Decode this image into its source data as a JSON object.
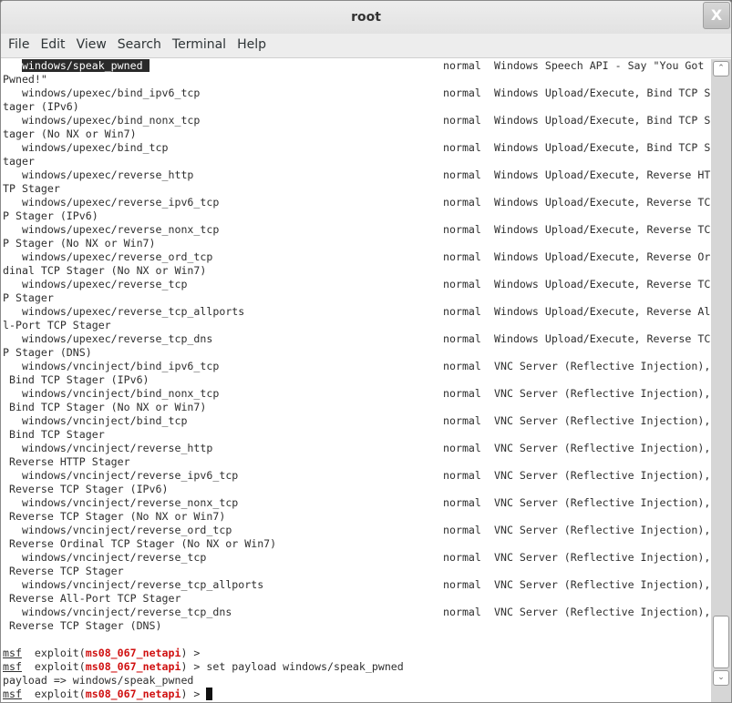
{
  "window": {
    "title": "root",
    "close_label": "X"
  },
  "menu": [
    "File",
    "Edit",
    "View",
    "Search",
    "Terminal",
    "Help"
  ],
  "entries": [
    {
      "name": "windows/speak_pwned",
      "rank": "normal",
      "desc": "Windows Speech API - Say \"You Got",
      "cont": "Pwned!\"",
      "selected": true
    },
    {
      "name": "windows/upexec/bind_ipv6_tcp",
      "rank": "normal",
      "desc": "Windows Upload/Execute, Bind TCP S",
      "cont": "tager (IPv6)"
    },
    {
      "name": "windows/upexec/bind_nonx_tcp",
      "rank": "normal",
      "desc": "Windows Upload/Execute, Bind TCP S",
      "cont": "tager (No NX or Win7)"
    },
    {
      "name": "windows/upexec/bind_tcp",
      "rank": "normal",
      "desc": "Windows Upload/Execute, Bind TCP S",
      "cont": "tager"
    },
    {
      "name": "windows/upexec/reverse_http",
      "rank": "normal",
      "desc": "Windows Upload/Execute, Reverse HT",
      "cont": "TP Stager"
    },
    {
      "name": "windows/upexec/reverse_ipv6_tcp",
      "rank": "normal",
      "desc": "Windows Upload/Execute, Reverse TC",
      "cont": "P Stager (IPv6)"
    },
    {
      "name": "windows/upexec/reverse_nonx_tcp",
      "rank": "normal",
      "desc": "Windows Upload/Execute, Reverse TC",
      "cont": "P Stager (No NX or Win7)"
    },
    {
      "name": "windows/upexec/reverse_ord_tcp",
      "rank": "normal",
      "desc": "Windows Upload/Execute, Reverse Or",
      "cont": "dinal TCP Stager (No NX or Win7)"
    },
    {
      "name": "windows/upexec/reverse_tcp",
      "rank": "normal",
      "desc": "Windows Upload/Execute, Reverse TC",
      "cont": "P Stager"
    },
    {
      "name": "windows/upexec/reverse_tcp_allports",
      "rank": "normal",
      "desc": "Windows Upload/Execute, Reverse Al",
      "cont": "l-Port TCP Stager"
    },
    {
      "name": "windows/upexec/reverse_tcp_dns",
      "rank": "normal",
      "desc": "Windows Upload/Execute, Reverse TC",
      "cont": "P Stager (DNS)"
    },
    {
      "name": "windows/vncinject/bind_ipv6_tcp",
      "rank": "normal",
      "desc": "VNC Server (Reflective Injection),",
      "cont": " Bind TCP Stager (IPv6)"
    },
    {
      "name": "windows/vncinject/bind_nonx_tcp",
      "rank": "normal",
      "desc": "VNC Server (Reflective Injection),",
      "cont": " Bind TCP Stager (No NX or Win7)"
    },
    {
      "name": "windows/vncinject/bind_tcp",
      "rank": "normal",
      "desc": "VNC Server (Reflective Injection),",
      "cont": " Bind TCP Stager"
    },
    {
      "name": "windows/vncinject/reverse_http",
      "rank": "normal",
      "desc": "VNC Server (Reflective Injection),",
      "cont": " Reverse HTTP Stager"
    },
    {
      "name": "windows/vncinject/reverse_ipv6_tcp",
      "rank": "normal",
      "desc": "VNC Server (Reflective Injection),",
      "cont": " Reverse TCP Stager (IPv6)"
    },
    {
      "name": "windows/vncinject/reverse_nonx_tcp",
      "rank": "normal",
      "desc": "VNC Server (Reflective Injection),",
      "cont": " Reverse TCP Stager (No NX or Win7)"
    },
    {
      "name": "windows/vncinject/reverse_ord_tcp",
      "rank": "normal",
      "desc": "VNC Server (Reflective Injection),",
      "cont": " Reverse Ordinal TCP Stager (No NX or Win7)"
    },
    {
      "name": "windows/vncinject/reverse_tcp",
      "rank": "normal",
      "desc": "VNC Server (Reflective Injection),",
      "cont": " Reverse TCP Stager"
    },
    {
      "name": "windows/vncinject/reverse_tcp_allports",
      "rank": "normal",
      "desc": "VNC Server (Reflective Injection),",
      "cont": " Reverse All-Port TCP Stager"
    },
    {
      "name": "windows/vncinject/reverse_tcp_dns",
      "rank": "normal",
      "desc": "VNC Server (Reflective Injection),",
      "cont": " Reverse TCP Stager (DNS)"
    }
  ],
  "prompt": {
    "msf": "msf",
    "exploit_pre": "  exploit(",
    "module": "ms08_067_netapi",
    "exploit_post": ") > "
  },
  "commands": [
    "",
    "set payload windows/speak_pwned",
    null,
    ""
  ],
  "output_line": "payload => windows/speak_pwned",
  "scrollbar": {
    "position_fraction": 0.95
  }
}
